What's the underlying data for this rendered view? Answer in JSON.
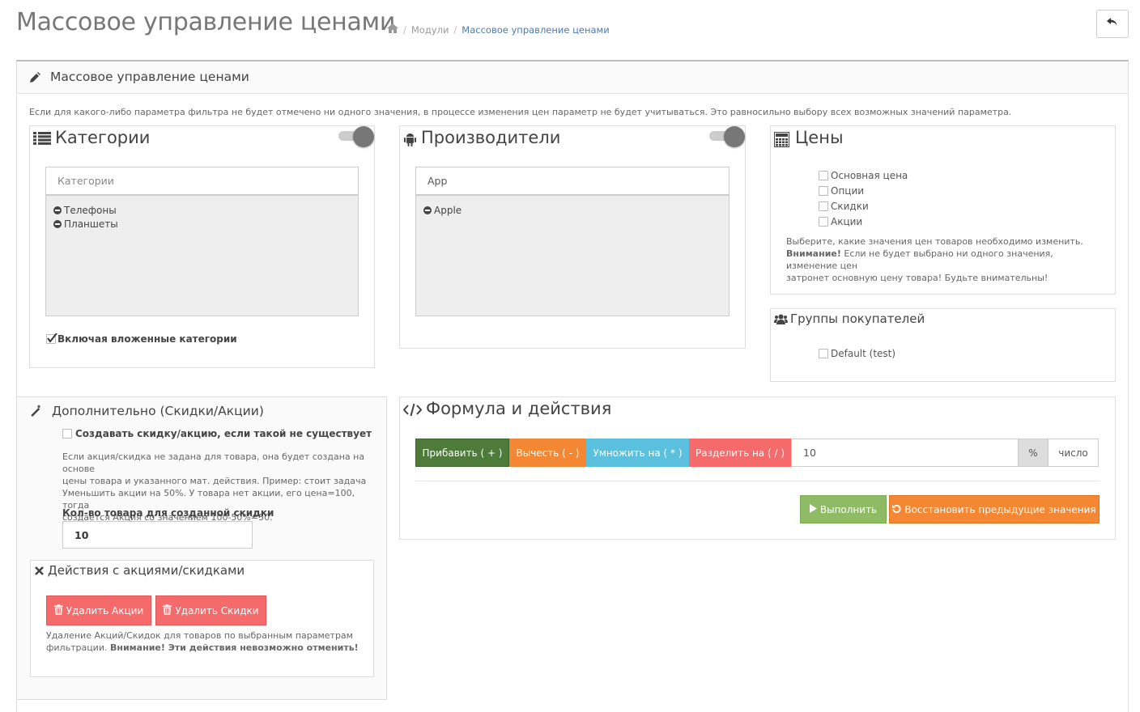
{
  "header": {
    "title": "Массовое управление ценами",
    "breadcrumb": [
      "Модули",
      "Массовое управление ценами"
    ]
  },
  "panel": {
    "title": "Массовое управление ценами",
    "notice": "Если для какого-либо параметра фильтра не будет отмечено ни одного значения, в процессе изменения цен параметр не будет учитываться. Это равносильно выбору всех возможных значений параметра."
  },
  "categories": {
    "title": "Категории",
    "placeholder": "Категории",
    "items": [
      "Телефоны",
      "Планшеты"
    ],
    "include_sub_label": "Включая вложенные категории"
  },
  "manufacturers": {
    "title": "Производители",
    "input_value": "App",
    "items": [
      "Apple"
    ]
  },
  "prices": {
    "title": "Цены",
    "options": [
      "Основная цена",
      "Опции",
      "Скидки",
      "Акции"
    ],
    "help_line1": "Выберите, какие значения цен товаров необходимо изменить.",
    "warning_label": "Внимание!",
    "help_line2": " Если не будет выбрано ни одного значения, изменение цен",
    "help_line3": "затронет основную цену товара! Будьте внимательны!"
  },
  "customer_groups": {
    "title": "Группы покупателей",
    "options": [
      "Default (test)"
    ]
  },
  "extra": {
    "title": "Дополнительно (Скидки/Акции)",
    "create_label": "Создавать скидку/акцию, если такой не существует",
    "help": [
      "Если акция/скидка не задана для товара, она будет создана на основе",
      "цены товара и указанного мат. действия. Пример: стоит задача",
      "Уменьшить акции на 50%. У товара нет акции, его цена=100, тогда",
      "создается Акция со значением 100-50%=50."
    ],
    "qty_label": "Кол-во товара для созданной скидки",
    "qty_value": "10"
  },
  "actions": {
    "title": "Действия с акциями/скидками",
    "delete_specials": "Удалить Акции",
    "delete_discounts": "Удалить Скидки",
    "note_line1": "Удаление Акций/Скидок для товаров по выбранным параметрам",
    "note_line2a": "фильтрации. ",
    "note_warning": "Внимание! Эти действия невозможно отменить!"
  },
  "formula": {
    "title": "Формула и действия",
    "add": "Прибавить ( + )",
    "subtract": "Вычесть ( - )",
    "multiply": "Умножить на ( * )",
    "divide": "Разделить на ( / )",
    "value": "10",
    "unit_percent": "%",
    "unit_number": "число",
    "execute": "Выполнить",
    "restore": "Восстановить предыдущие значения"
  },
  "colors": {
    "green_dark": "#4e7a3a",
    "orange": "#f38733",
    "blue": "#5bc0de",
    "red": "#f56b6b",
    "green_light": "#8fbb64",
    "link": "#4a7bb7"
  }
}
